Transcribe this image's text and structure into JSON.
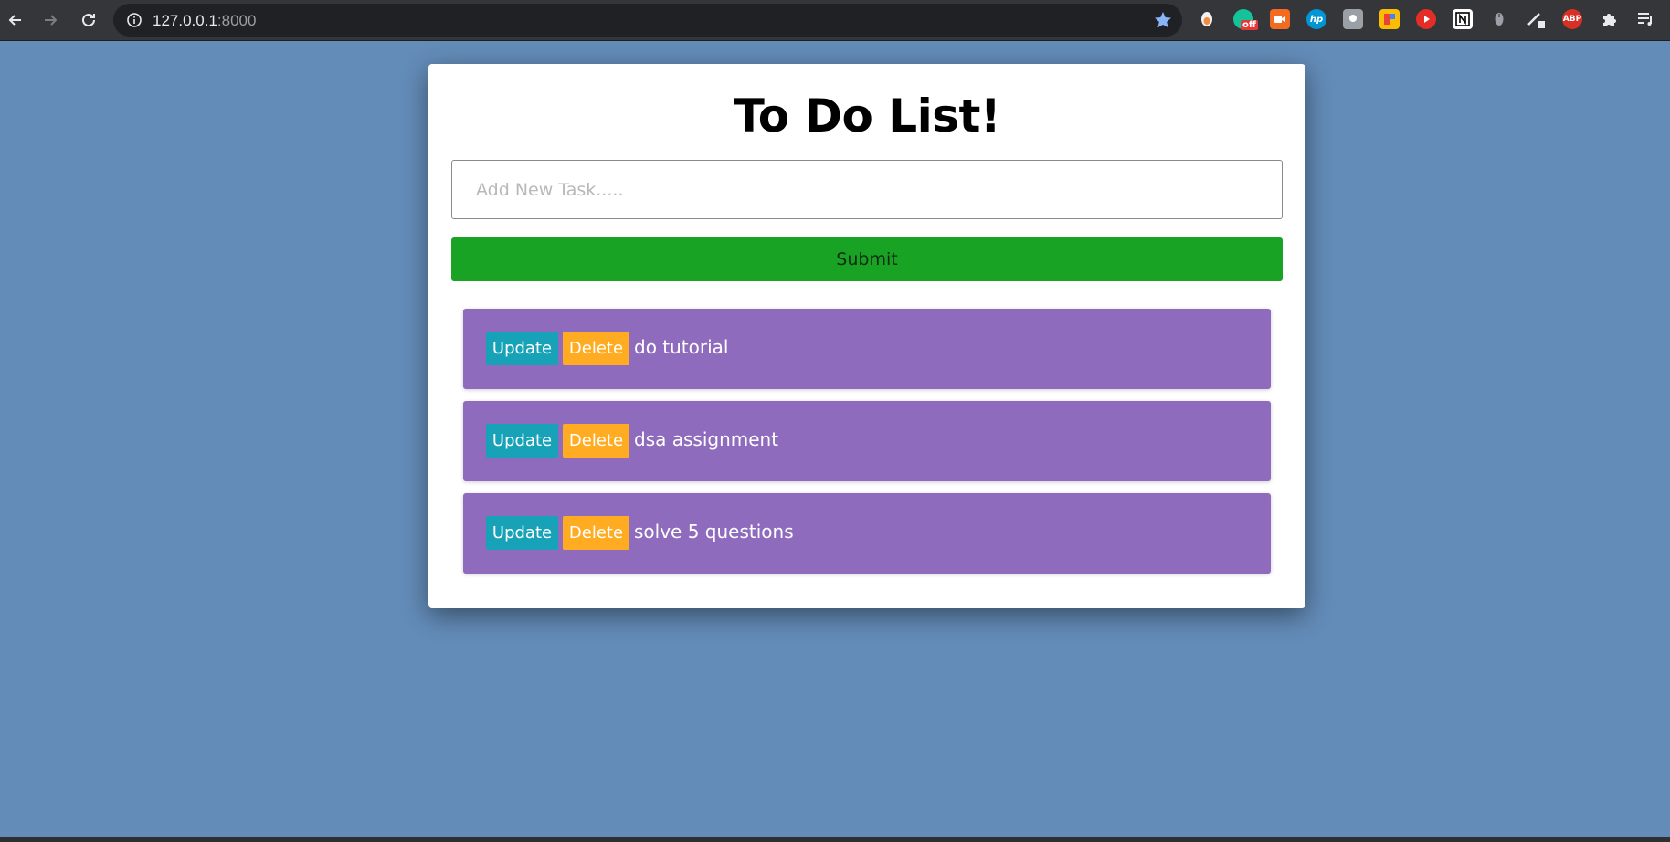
{
  "browser": {
    "url_host": "127.0.0.1",
    "url_port": ":8000",
    "ext_abp_label": "ABP",
    "ext_off_badge": "off",
    "ext_hp_label": "hp"
  },
  "app": {
    "title": "To Do List!",
    "input": {
      "placeholder": "Add New Task.....",
      "value": ""
    },
    "submit_label": "Submit",
    "tasks": [
      {
        "update_label": "Update",
        "delete_label": "Delete",
        "text": "do tutorial"
      },
      {
        "update_label": "Update",
        "delete_label": "Delete",
        "text": "dsa assignment"
      },
      {
        "update_label": "Update",
        "delete_label": "Delete",
        "text": "solve 5 questions"
      }
    ]
  },
  "colors": {
    "page_background": "#638cb8",
    "submit": "#18a324",
    "task_background": "#8f6bbd",
    "update": "#17a2b8",
    "delete": "#ffac22"
  }
}
